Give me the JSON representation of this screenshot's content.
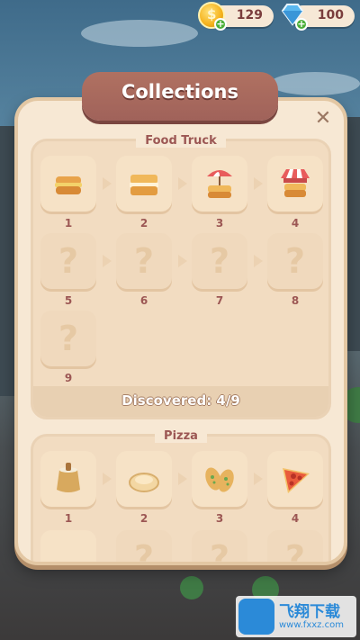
{
  "currency": {
    "coins": "129",
    "gems": "100",
    "coin_icon": "coin-icon",
    "gem_icon": "gem-icon"
  },
  "panel": {
    "title": "Collections",
    "close_icon": "close-icon"
  },
  "food_truck": {
    "title": "Food Truck",
    "discovered": "Discovered: 4/9",
    "items": [
      {
        "num": "1",
        "icon": "sandwich-icon",
        "unlocked": true
      },
      {
        "num": "2",
        "icon": "toasted-sandwich-icon",
        "unlocked": true
      },
      {
        "num": "3",
        "icon": "sandwich-umbrella-icon",
        "unlocked": true
      },
      {
        "num": "4",
        "icon": "sandwich-stand-icon",
        "unlocked": true
      },
      {
        "num": "5",
        "icon": "question-icon",
        "unlocked": false
      },
      {
        "num": "6",
        "icon": "question-icon",
        "unlocked": false
      },
      {
        "num": "7",
        "icon": "question-icon",
        "unlocked": false
      },
      {
        "num": "8",
        "icon": "question-icon",
        "unlocked": false
      },
      {
        "num": "9",
        "icon": "question-icon",
        "unlocked": false
      }
    ]
  },
  "pizza": {
    "title": "Pizza",
    "items": [
      {
        "num": "1",
        "icon": "flour-sack-icon",
        "unlocked": true
      },
      {
        "num": "2",
        "icon": "dough-icon",
        "unlocked": true
      },
      {
        "num": "3",
        "icon": "garlic-bread-icon",
        "unlocked": true
      },
      {
        "num": "4",
        "icon": "pizza-slice-icon",
        "unlocked": true
      }
    ]
  },
  "watermark": {
    "text": "飞翔下载",
    "url": "www.fxxz.com"
  },
  "colors": {
    "panel_bg": "#f7e8d4",
    "header_bg": "#a0625a",
    "label_color": "#9c5754"
  }
}
